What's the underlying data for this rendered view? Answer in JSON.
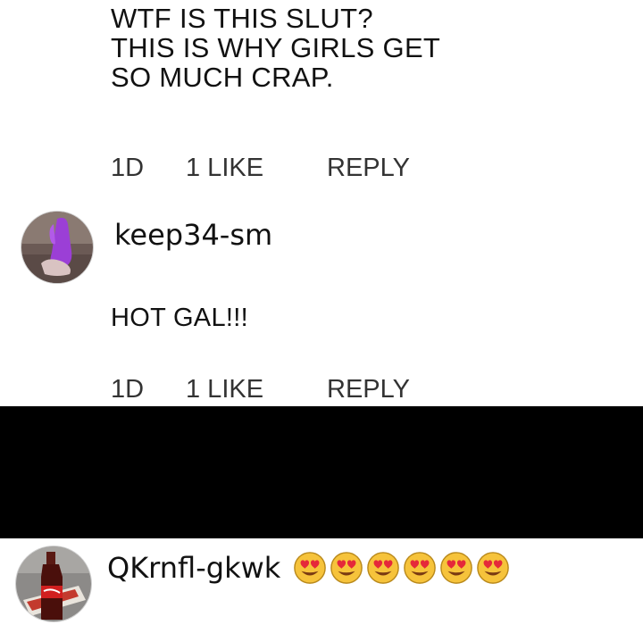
{
  "comments": [
    {
      "text_lines": [
        "WTF IS THIS SLUT?",
        "THIS IS WHY GIRLS GET",
        "SO MUCH CRAP."
      ],
      "time": "1D",
      "likes": "1 LIKE",
      "reply_label": "REPLY"
    },
    {
      "username": "keep34-sm",
      "avatar_icon": "purple-toy-avatar",
      "text": "HOT GAL!!!",
      "time": "1D",
      "likes": "1 LIKE",
      "reply_label": "REPLY"
    },
    {
      "username": "QKrnfl-gkwk",
      "avatar_icon": "cola-bottle-avatar",
      "emoji_icon": "heart-eyes-emoji",
      "emoji_count": 6
    }
  ],
  "colors": {
    "background": "#ffffff",
    "text": "#111111",
    "meta_text": "#333333",
    "redaction_bar": "#000000",
    "emoji_face": "#f6c33b",
    "emoji_heart": "#e5283a"
  }
}
